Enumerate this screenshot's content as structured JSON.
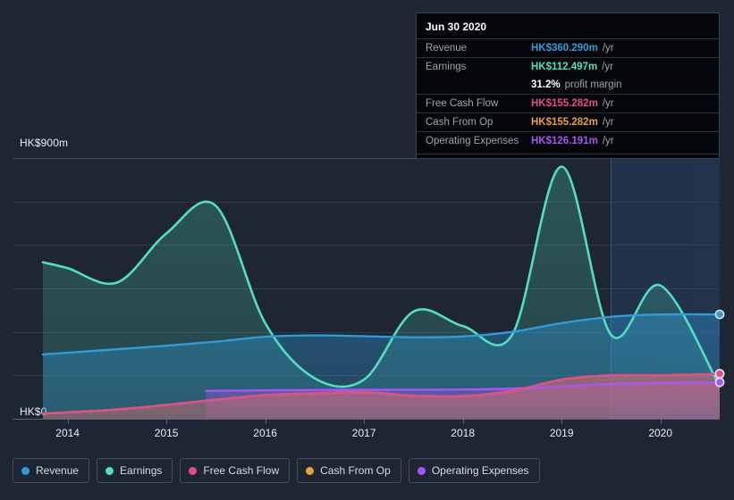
{
  "axis": {
    "y_top_label": "HK$900m",
    "y_zero_label": "HK$0",
    "x_ticks": [
      "2014",
      "2015",
      "2016",
      "2017",
      "2018",
      "2019",
      "2020"
    ]
  },
  "tooltip": {
    "date": "Jun 30 2020",
    "rows": [
      {
        "label": "Revenue",
        "value": "HK$360.290m",
        "unit": "/yr",
        "color": "#2e9bdd"
      },
      {
        "label": "Earnings",
        "value": "HK$112.497m",
        "unit": "/yr",
        "color": "#4fe0bd"
      },
      {
        "label": "Free Cash Flow",
        "value": "HK$155.282m",
        "unit": "/yr",
        "color": "#e84a87"
      },
      {
        "label": "Cash From Op",
        "value": "HK$155.282m",
        "unit": "/yr",
        "color": "#e8a33d"
      },
      {
        "label": "Operating Expenses",
        "value": "HK$126.191m",
        "unit": "/yr",
        "color": "#a855f7"
      }
    ],
    "margin_value": "31.2%",
    "margin_label": "profit margin"
  },
  "legend": [
    {
      "label": "Revenue",
      "color": "#2e9bdd"
    },
    {
      "label": "Earnings",
      "color": "#4fe0bd"
    },
    {
      "label": "Free Cash Flow",
      "color": "#e84a87"
    },
    {
      "label": "Cash From Op",
      "color": "#e8a33d"
    },
    {
      "label": "Operating Expenses",
      "color": "#a855f7"
    }
  ],
  "chart_data": {
    "type": "area",
    "title": "",
    "xlabel": "",
    "ylabel": "HK$",
    "ylim": [
      0,
      900
    ],
    "xlim": [
      2013.75,
      2020.6
    ],
    "grid": true,
    "legend_position": "bottom",
    "y_tick_values": [
      0,
      150,
      300,
      450,
      600,
      750,
      900
    ],
    "y_tick_labels": [
      "HK$0",
      "",
      "",
      "",
      "",
      "",
      "HK$900m"
    ],
    "x_tick_values": [
      2014,
      2015,
      2016,
      2017,
      2018,
      2019,
      2020
    ],
    "currency": "HK$",
    "units": "millions per year",
    "highlight_date": "Jun 30 2020",
    "forecast_boundary_x": 2019.5,
    "series": [
      {
        "name": "Revenue",
        "color": "#2e9bdd",
        "x": [
          2013.75,
          2014.0,
          2014.5,
          2015.0,
          2015.5,
          2016.0,
          2016.5,
          2017.0,
          2017.5,
          2018.0,
          2018.5,
          2019.0,
          2019.5,
          2020.0,
          2020.6
        ],
        "values": [
          222,
          228,
          240,
          252,
          266,
          283,
          288,
          285,
          281,
          284,
          300,
          330,
          352,
          360,
          360
        ]
      },
      {
        "name": "Earnings",
        "color": "#4fe0bd",
        "x": [
          2013.75,
          2014.0,
          2014.5,
          2015.0,
          2015.5,
          2016.0,
          2016.5,
          2017.0,
          2017.5,
          2018.0,
          2018.5,
          2019.0,
          2019.5,
          2020.0,
          2020.6
        ],
        "values": [
          540,
          520,
          470,
          640,
          735,
          330,
          140,
          135,
          370,
          320,
          290,
          870,
          290,
          460,
          112
        ]
      },
      {
        "name": "Free Cash Flow",
        "color": "#e84a87",
        "x": [
          2013.75,
          2014.0,
          2014.5,
          2015.0,
          2015.5,
          2016.0,
          2016.5,
          2017.0,
          2017.5,
          2018.0,
          2018.5,
          2019.0,
          2019.5,
          2020.0,
          2020.6
        ],
        "values": [
          18,
          22,
          32,
          48,
          66,
          82,
          88,
          92,
          80,
          78,
          96,
          135,
          150,
          150,
          155
        ]
      },
      {
        "name": "Cash From Op",
        "color": "#e8a33d",
        "x": [
          2013.75,
          2014.0,
          2014.5,
          2015.0,
          2015.5,
          2016.0,
          2016.5,
          2017.0,
          2017.5,
          2018.0,
          2018.5,
          2019.0,
          2019.5,
          2020.0,
          2020.6
        ],
        "values": [
          18,
          22,
          32,
          48,
          66,
          82,
          88,
          92,
          80,
          78,
          96,
          135,
          150,
          150,
          155
        ]
      },
      {
        "name": "Operating Expenses",
        "color": "#a855f7",
        "x": [
          2015.4,
          2016.0,
          2016.5,
          2017.0,
          2017.5,
          2018.0,
          2018.5,
          2019.0,
          2019.5,
          2020.0,
          2020.6
        ],
        "values": [
          96,
          98,
          99,
          100,
          100,
          101,
          104,
          112,
          120,
          124,
          126
        ]
      }
    ],
    "end_markers": [
      {
        "series": "Revenue",
        "value": 360.29
      },
      {
        "series": "Cash From Op",
        "value": 155.282
      },
      {
        "series": "Free Cash Flow",
        "value": 155.282
      },
      {
        "series": "Operating Expenses",
        "value": 126.191
      }
    ]
  }
}
